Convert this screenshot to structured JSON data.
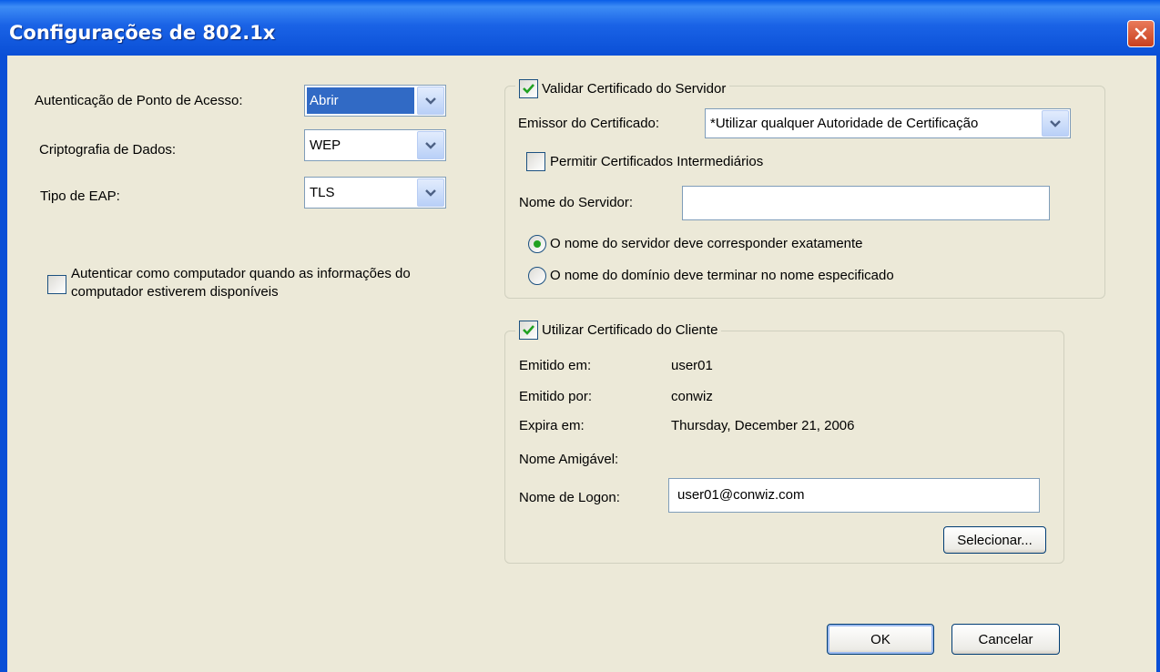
{
  "window": {
    "title": "Configurações de 802.1x"
  },
  "left": {
    "auth_label": "Autenticação de Ponto de Acesso:",
    "auth_value": "Abrir",
    "crypto_label": "Criptografia de Dados:",
    "crypto_value": "WEP",
    "eap_label": "Tipo de EAP:",
    "eap_value": "TLS",
    "computer_auth_line1": "Autenticar como computador quando as informações do",
    "computer_auth_line2": "computador estiverem disponíveis",
    "computer_auth_checked": false
  },
  "server_cert": {
    "legend": "Validar Certificado do Servidor",
    "checked": true,
    "issuer_label": "Emissor do Certificado:",
    "issuer_value": "*Utilizar qualquer Autoridade de Certificação",
    "allow_intermediate_label": "Permitir Certificados Intermediários",
    "allow_intermediate_checked": false,
    "server_name_label": "Nome do Servidor:",
    "server_name_value": "",
    "radio_exact_label": "O nome do servidor deve corresponder exatamente",
    "radio_domain_label": "O nome do domínio deve terminar no nome especificado",
    "selected_radio": "exact"
  },
  "client_cert": {
    "legend": "Utilizar Certificado do Cliente",
    "checked": true,
    "issued_to_label": "Emitido em:",
    "issued_to_value": "user01",
    "issued_by_label": "Emitido por:",
    "issued_by_value": "conwiz",
    "expires_label": "Expira em:",
    "expires_value": "Thursday, December 21, 2006",
    "friendly_name_label": "Nome Amigável:",
    "friendly_name_value": "",
    "logon_name_label": "Nome de Logon:",
    "logon_name_value": "user01@conwiz.com",
    "select_button": "Selecionar..."
  },
  "footer": {
    "ok_button": "OK",
    "cancel_button": "Cancelar"
  },
  "colors": {
    "title_bar": "#0a4fd6",
    "dialog_bg": "#ece9d8",
    "check_mark": "#21a121",
    "close_button": "#c8401e",
    "selection": "#316ac5"
  },
  "icons": [
    "close-icon",
    "chevron-down-icon",
    "check-icon"
  ]
}
